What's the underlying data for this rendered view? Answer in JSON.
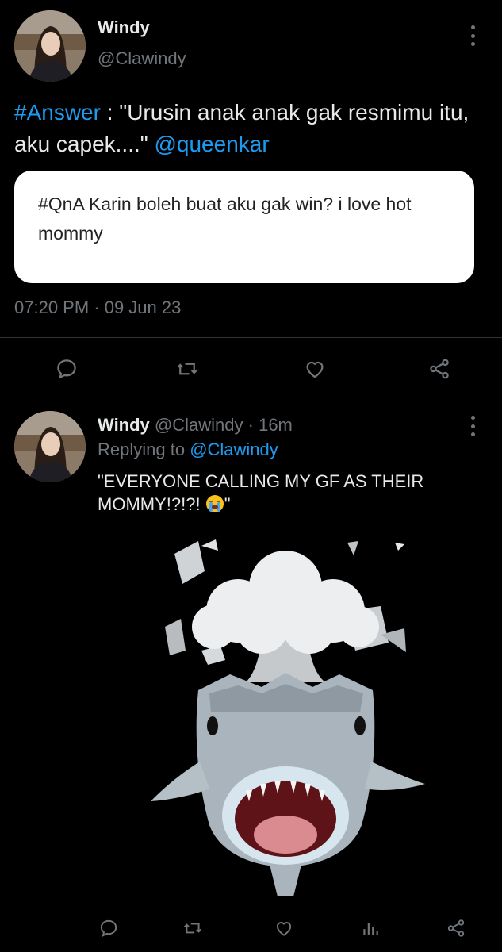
{
  "tweet1": {
    "author_name": "Windy",
    "author_handle": "@Clawindy",
    "hashtag": "#Answer",
    "text": " : \"Urusin anak anak gak resmimu itu, aku capek....\" ",
    "mention": "@queenkar",
    "card_text": "#QnA Karin boleh buat aku gak win? i love hot mommy",
    "timestamp": "07:20 PM · 09 Jun 23"
  },
  "tweet2": {
    "author_name": "Windy",
    "author_handle": "@Clawindy",
    "time_ago": "· 16m",
    "replying_prefix": "Replying to ",
    "replying_handle": "@Clawindy",
    "text": "\"EVERYONE CALLING MY GF AS THEIR MOMMY!?!?! ",
    "text_end": "\""
  },
  "icons": {
    "reply": "reply-icon",
    "retweet": "retweet-icon",
    "like": "heart-icon",
    "share": "share-icon",
    "views": "views-icon",
    "more": "more-vertical-icon",
    "crying_emoji": "loudly-crying-face-emoji",
    "media": "exploding-head-shark-memoji"
  },
  "colors": {
    "background": "#000000",
    "text": "#e7e9ea",
    "muted": "#71767b",
    "link": "#1d9bf0"
  }
}
